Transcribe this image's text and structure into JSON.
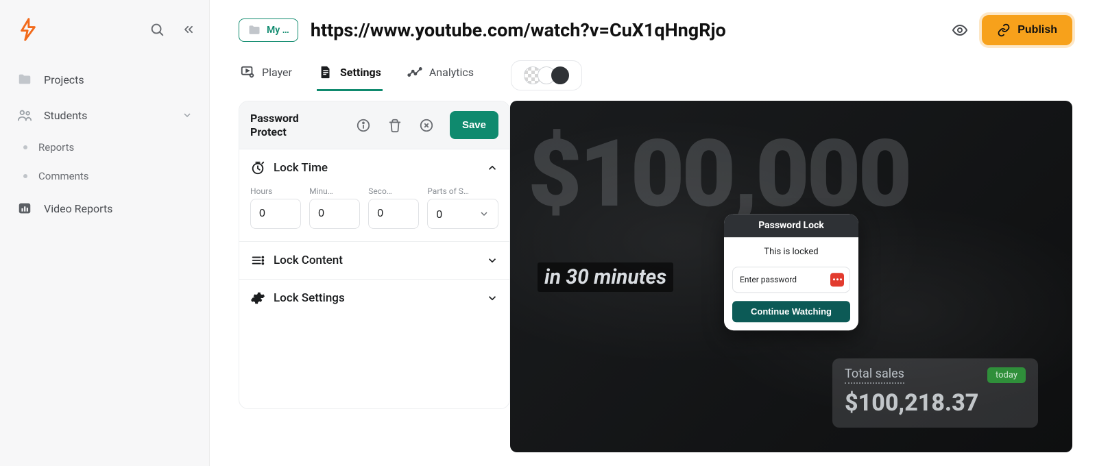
{
  "sidebar": {
    "items": [
      {
        "label": "Projects",
        "icon": "folder-icon",
        "expandable": false
      },
      {
        "label": "Students",
        "icon": "people-icon",
        "expandable": true
      },
      {
        "label": "Reports",
        "icon": "dot-icon",
        "sub": true
      },
      {
        "label": "Comments",
        "icon": "dot-icon",
        "sub": true
      },
      {
        "label": "Video Reports",
        "icon": "bar-chart-icon",
        "expandable": false
      }
    ]
  },
  "header": {
    "breadcrumb_chip": "My …",
    "title": "https://www.youtube.com/watch?v=CuX1qHngRjo",
    "publish_label": "Publish"
  },
  "tabs": {
    "player": "Player",
    "settings": "Settings",
    "analytics": "Analytics",
    "active": "settings"
  },
  "panel": {
    "title": "Password Protect",
    "save_label": "Save",
    "sections": {
      "lock_time": {
        "title": "Lock Time",
        "expanded": true
      },
      "lock_content": {
        "title": "Lock Content",
        "expanded": false
      },
      "lock_settings": {
        "title": "Lock Settings",
        "expanded": false
      }
    },
    "lock_time_fields": {
      "hours": {
        "label": "Hours",
        "value": "0"
      },
      "minutes": {
        "label": "Minu…",
        "value": "0"
      },
      "seconds": {
        "label": "Seco…",
        "value": "0"
      },
      "parts": {
        "label": "Parts of S…",
        "value": "0"
      }
    }
  },
  "preview": {
    "big_price": "$100,000",
    "subline": "in 30 minutes",
    "lock_dialog": {
      "heading": "Password Lock",
      "message": "This is locked",
      "placeholder": "Enter password",
      "cta": "Continue Watching"
    },
    "sales_card": {
      "label": "Total sales",
      "badge": "today",
      "amount": "$100,218.37"
    }
  },
  "colors": {
    "accent_green": "#0f8a6e",
    "publish_orange": "#f7a11b",
    "continue_teal": "#0c5a56",
    "password_badge_red": "#e23b2e"
  }
}
